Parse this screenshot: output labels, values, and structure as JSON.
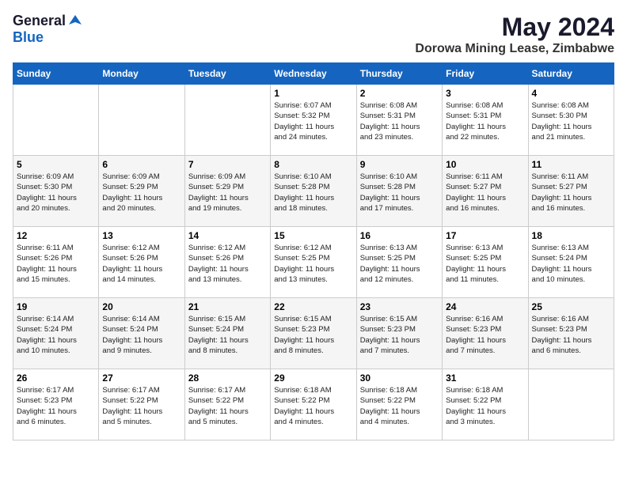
{
  "logo": {
    "general": "General",
    "blue": "Blue"
  },
  "title": "May 2024",
  "subtitle": "Dorowa Mining Lease, Zimbabwe",
  "days_of_week": [
    "Sunday",
    "Monday",
    "Tuesday",
    "Wednesday",
    "Thursday",
    "Friday",
    "Saturday"
  ],
  "weeks": [
    [
      {
        "day": "",
        "info": ""
      },
      {
        "day": "",
        "info": ""
      },
      {
        "day": "",
        "info": ""
      },
      {
        "day": "1",
        "info": "Sunrise: 6:07 AM\nSunset: 5:32 PM\nDaylight: 11 hours\nand 24 minutes."
      },
      {
        "day": "2",
        "info": "Sunrise: 6:08 AM\nSunset: 5:31 PM\nDaylight: 11 hours\nand 23 minutes."
      },
      {
        "day": "3",
        "info": "Sunrise: 6:08 AM\nSunset: 5:31 PM\nDaylight: 11 hours\nand 22 minutes."
      },
      {
        "day": "4",
        "info": "Sunrise: 6:08 AM\nSunset: 5:30 PM\nDaylight: 11 hours\nand 21 minutes."
      }
    ],
    [
      {
        "day": "5",
        "info": "Sunrise: 6:09 AM\nSunset: 5:30 PM\nDaylight: 11 hours\nand 20 minutes."
      },
      {
        "day": "6",
        "info": "Sunrise: 6:09 AM\nSunset: 5:29 PM\nDaylight: 11 hours\nand 20 minutes."
      },
      {
        "day": "7",
        "info": "Sunrise: 6:09 AM\nSunset: 5:29 PM\nDaylight: 11 hours\nand 19 minutes."
      },
      {
        "day": "8",
        "info": "Sunrise: 6:10 AM\nSunset: 5:28 PM\nDaylight: 11 hours\nand 18 minutes."
      },
      {
        "day": "9",
        "info": "Sunrise: 6:10 AM\nSunset: 5:28 PM\nDaylight: 11 hours\nand 17 minutes."
      },
      {
        "day": "10",
        "info": "Sunrise: 6:11 AM\nSunset: 5:27 PM\nDaylight: 11 hours\nand 16 minutes."
      },
      {
        "day": "11",
        "info": "Sunrise: 6:11 AM\nSunset: 5:27 PM\nDaylight: 11 hours\nand 16 minutes."
      }
    ],
    [
      {
        "day": "12",
        "info": "Sunrise: 6:11 AM\nSunset: 5:26 PM\nDaylight: 11 hours\nand 15 minutes."
      },
      {
        "day": "13",
        "info": "Sunrise: 6:12 AM\nSunset: 5:26 PM\nDaylight: 11 hours\nand 14 minutes."
      },
      {
        "day": "14",
        "info": "Sunrise: 6:12 AM\nSunset: 5:26 PM\nDaylight: 11 hours\nand 13 minutes."
      },
      {
        "day": "15",
        "info": "Sunrise: 6:12 AM\nSunset: 5:25 PM\nDaylight: 11 hours\nand 13 minutes."
      },
      {
        "day": "16",
        "info": "Sunrise: 6:13 AM\nSunset: 5:25 PM\nDaylight: 11 hours\nand 12 minutes."
      },
      {
        "day": "17",
        "info": "Sunrise: 6:13 AM\nSunset: 5:25 PM\nDaylight: 11 hours\nand 11 minutes."
      },
      {
        "day": "18",
        "info": "Sunrise: 6:13 AM\nSunset: 5:24 PM\nDaylight: 11 hours\nand 10 minutes."
      }
    ],
    [
      {
        "day": "19",
        "info": "Sunrise: 6:14 AM\nSunset: 5:24 PM\nDaylight: 11 hours\nand 10 minutes."
      },
      {
        "day": "20",
        "info": "Sunrise: 6:14 AM\nSunset: 5:24 PM\nDaylight: 11 hours\nand 9 minutes."
      },
      {
        "day": "21",
        "info": "Sunrise: 6:15 AM\nSunset: 5:24 PM\nDaylight: 11 hours\nand 8 minutes."
      },
      {
        "day": "22",
        "info": "Sunrise: 6:15 AM\nSunset: 5:23 PM\nDaylight: 11 hours\nand 8 minutes."
      },
      {
        "day": "23",
        "info": "Sunrise: 6:15 AM\nSunset: 5:23 PM\nDaylight: 11 hours\nand 7 minutes."
      },
      {
        "day": "24",
        "info": "Sunrise: 6:16 AM\nSunset: 5:23 PM\nDaylight: 11 hours\nand 7 minutes."
      },
      {
        "day": "25",
        "info": "Sunrise: 6:16 AM\nSunset: 5:23 PM\nDaylight: 11 hours\nand 6 minutes."
      }
    ],
    [
      {
        "day": "26",
        "info": "Sunrise: 6:17 AM\nSunset: 5:23 PM\nDaylight: 11 hours\nand 6 minutes."
      },
      {
        "day": "27",
        "info": "Sunrise: 6:17 AM\nSunset: 5:22 PM\nDaylight: 11 hours\nand 5 minutes."
      },
      {
        "day": "28",
        "info": "Sunrise: 6:17 AM\nSunset: 5:22 PM\nDaylight: 11 hours\nand 5 minutes."
      },
      {
        "day": "29",
        "info": "Sunrise: 6:18 AM\nSunset: 5:22 PM\nDaylight: 11 hours\nand 4 minutes."
      },
      {
        "day": "30",
        "info": "Sunrise: 6:18 AM\nSunset: 5:22 PM\nDaylight: 11 hours\nand 4 minutes."
      },
      {
        "day": "31",
        "info": "Sunrise: 6:18 AM\nSunset: 5:22 PM\nDaylight: 11 hours\nand 3 minutes."
      },
      {
        "day": "",
        "info": ""
      }
    ]
  ]
}
